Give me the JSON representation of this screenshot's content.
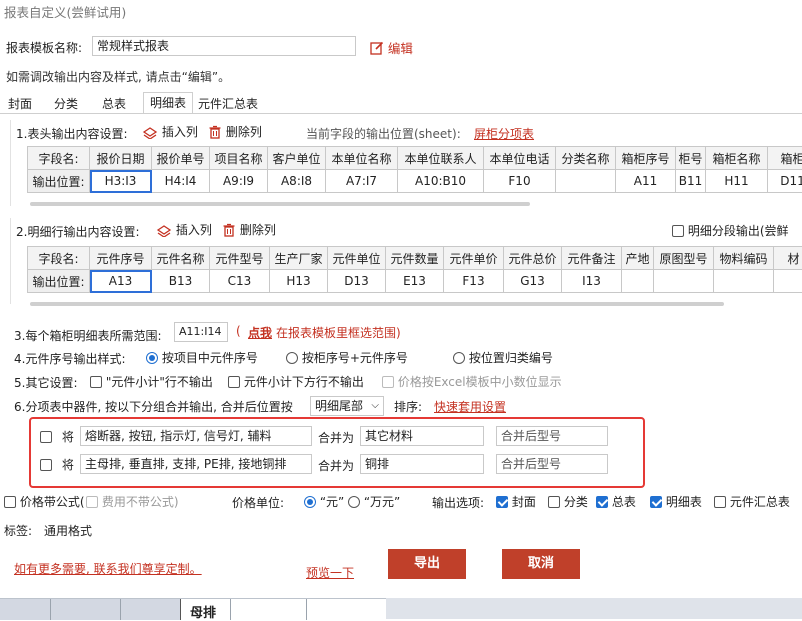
{
  "window": {
    "title": "报表自定义(尝鲜试用)"
  },
  "template": {
    "label": "报表模板名称:",
    "value": "常规样式报表",
    "edit_label": "编辑",
    "hint": "如需调改输出内容及样式, 请点击“编辑”。"
  },
  "tabs": [
    {
      "label": "封面",
      "active": false
    },
    {
      "label": "分类",
      "active": false
    },
    {
      "label": "总表",
      "active": false
    },
    {
      "label": "明细表",
      "active": true
    },
    {
      "label": "元件汇总表",
      "active": false
    }
  ],
  "section1": {
    "title": "1.表头输出内容设置:",
    "insert_col": "插入列",
    "delete_col": "删除列",
    "position_label": "当前字段的输出位置(sheet):",
    "position_link": "屏柜分项表",
    "row_field": "字段名:",
    "row_pos": "输出位置:",
    "columns": [
      {
        "name": "报价日期",
        "pos": "H3:I3"
      },
      {
        "name": "报价单号",
        "pos": "H4:I4"
      },
      {
        "name": "项目名称",
        "pos": "A9:I9"
      },
      {
        "name": "客户单位",
        "pos": "A8:I8"
      },
      {
        "name": "本单位名称",
        "pos": "A7:I7"
      },
      {
        "name": "本单位联系人",
        "pos": "A10:B10"
      },
      {
        "name": "本单位电话",
        "pos": "F10"
      },
      {
        "name": "分类名称",
        "pos": ""
      },
      {
        "name": "箱柜序号",
        "pos": "A11"
      },
      {
        "name": "柜号",
        "pos": "B11"
      },
      {
        "name": "箱柜名称",
        "pos": "H11"
      },
      {
        "name": "箱柜",
        "pos": "D11"
      }
    ]
  },
  "section2": {
    "title": "2.明细行输出内容设置:",
    "insert_col": "插入列",
    "delete_col": "删除列",
    "split_label": "明细分段输出(尝鲜",
    "row_field": "字段名:",
    "row_pos": "输出位置:",
    "columns": [
      {
        "name": "元件序号",
        "pos": "A13"
      },
      {
        "name": "元件名称",
        "pos": "B13"
      },
      {
        "name": "元件型号",
        "pos": "C13"
      },
      {
        "name": "生产厂家",
        "pos": "H13"
      },
      {
        "name": "元件单位",
        "pos": "D13"
      },
      {
        "name": "元件数量",
        "pos": "E13"
      },
      {
        "name": "元件单价",
        "pos": "F13"
      },
      {
        "name": "元件总价",
        "pos": "G13"
      },
      {
        "name": "元件备注",
        "pos": "I13"
      },
      {
        "name": "产地",
        "pos": ""
      },
      {
        "name": "原图型号",
        "pos": ""
      },
      {
        "name": "物料编码",
        "pos": ""
      },
      {
        "name": "材",
        "pos": ""
      }
    ]
  },
  "opt3": {
    "label": "3.每个箱柜明细表所需范围:",
    "value": "A11:I14",
    "paren_open": "(",
    "link": "点我",
    "link_tail": "在报表模板里框选范围)"
  },
  "opt4": {
    "label": "4.元件序号输出样式:",
    "options": [
      "按项目中元件序号",
      "按柜序号+元件序号",
      "按位置归类编号"
    ]
  },
  "opt5": {
    "label": "5.其它设置:",
    "options": [
      "\"元件小计\"行不输出",
      "元件小计下方行不输出",
      "价格按Excel模板中小数位显示"
    ]
  },
  "opt6": {
    "label": "6.分项表中器件, 按以下分组合并输出, 合并后位置按",
    "select_value": "明细尾部",
    "sort_label": "排序:",
    "quick_link": "快速套用设置"
  },
  "merge": {
    "rows": [
      {
        "prefix": "将",
        "items": "熔断器, 按钮, 指示灯, 信号灯, 辅料",
        "merge_as": "合并为",
        "target": "其它材料",
        "model_placeholder": "合并后型号"
      },
      {
        "prefix": "将",
        "items": "主母排, 垂直排, 支排, PE排, 接地铜排",
        "merge_as": "合并为",
        "target": "铜排",
        "model_placeholder": "合并后型号"
      }
    ]
  },
  "footer": {
    "price_formula": "价格带公式(",
    "no_fee_formula": "费用不带公式)",
    "price_unit_label": "价格单位:",
    "unit_yuan": "“元”",
    "unit_wanyuan": "“万元”",
    "output_label": "输出选项:",
    "outputs": [
      "封面",
      "分类",
      "总表",
      "明细表",
      "元件汇总表"
    ],
    "tag_label": "标签:",
    "tag_value": "通用格式",
    "custom_link": "如有更多需要, 联系我们尊享定制。",
    "preview_link": "预览一下",
    "export_btn": "导出",
    "cancel_btn": "取消",
    "strip_text": "母排"
  },
  "colors": {
    "accent": "#c0402a",
    "link": "#c43121",
    "check": "#1f6fd1",
    "highlight": "#e53935"
  }
}
